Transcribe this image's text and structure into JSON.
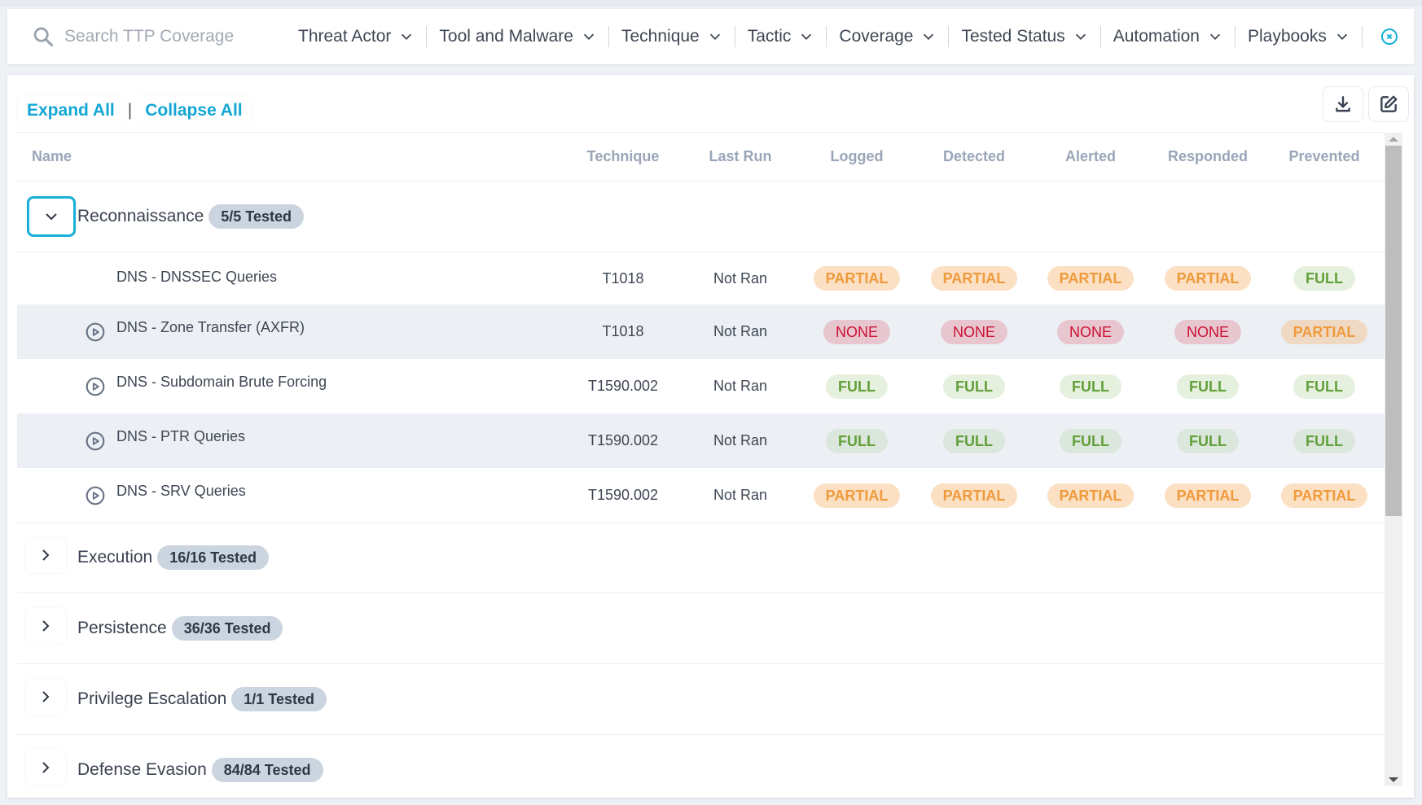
{
  "filterbar": {
    "search_placeholder": "Search TTP Coverage",
    "search_value": "",
    "filters": [
      {
        "label": "Threat Actor"
      },
      {
        "label": "Tool and Malware"
      },
      {
        "label": "Technique"
      },
      {
        "label": "Tactic"
      },
      {
        "label": "Coverage"
      },
      {
        "label": "Tested Status"
      },
      {
        "label": "Automation"
      },
      {
        "label": "Playbooks"
      }
    ],
    "clear_icon": "close-circle-icon"
  },
  "toolbar": {
    "expand_all": "Expand All",
    "separator": "|",
    "collapse_all": "Collapse All",
    "download_icon": "download-icon",
    "edit_icon": "edit-icon"
  },
  "table": {
    "columns": [
      "Name",
      "Technique",
      "Last Run",
      "Logged",
      "Detected",
      "Alerted",
      "Responded",
      "Prevented"
    ],
    "groups": [
      {
        "name": "Reconnaissance",
        "badge": "5/5 Tested",
        "expanded": true,
        "rows": [
          {
            "name": "DNS - DNSSEC Queries",
            "has_play": false,
            "technique": "T1018",
            "last_run": "Not Ran",
            "logged": "PARTIAL",
            "detected": "PARTIAL",
            "alerted": "PARTIAL",
            "responded": "PARTIAL",
            "prevented": "FULL"
          },
          {
            "name": "DNS - Zone Transfer (AXFR)",
            "has_play": true,
            "technique": "T1018",
            "last_run": "Not Ran",
            "logged": "NONE",
            "detected": "NONE",
            "alerted": "NONE",
            "responded": "NONE",
            "prevented": "PARTIAL"
          },
          {
            "name": "DNS - Subdomain Brute Forcing",
            "has_play": true,
            "technique": "T1590.002",
            "last_run": "Not Ran",
            "logged": "FULL",
            "detected": "FULL",
            "alerted": "FULL",
            "responded": "FULL",
            "prevented": "FULL"
          },
          {
            "name": "DNS - PTR Queries",
            "has_play": true,
            "technique": "T1590.002",
            "last_run": "Not Ran",
            "logged": "FULL",
            "detected": "FULL",
            "alerted": "FULL",
            "responded": "FULL",
            "prevented": "FULL"
          },
          {
            "name": "DNS - SRV Queries",
            "has_play": true,
            "technique": "T1590.002",
            "last_run": "Not Ran",
            "logged": "PARTIAL",
            "detected": "PARTIAL",
            "alerted": "PARTIAL",
            "responded": "PARTIAL",
            "prevented": "PARTIAL"
          }
        ]
      },
      {
        "name": "Execution",
        "badge": "16/16 Tested",
        "expanded": false,
        "rows": []
      },
      {
        "name": "Persistence",
        "badge": "36/36 Tested",
        "expanded": false,
        "rows": []
      },
      {
        "name": "Privilege Escalation",
        "badge": "1/1 Tested",
        "expanded": false,
        "rows": []
      },
      {
        "name": "Defense Evasion",
        "badge": "84/84 Tested",
        "expanded": false,
        "rows": []
      }
    ]
  },
  "colors": {
    "accent": "#12a7d4",
    "full_text": "#62a03a",
    "partial_text": "#ef9a3c",
    "none_text": "#cc1133",
    "badge_bg": "#cbd5e0"
  }
}
